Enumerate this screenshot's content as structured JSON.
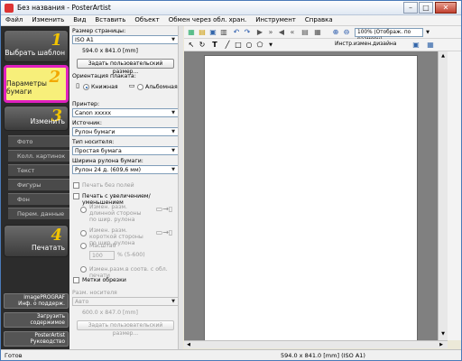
{
  "window": {
    "title": "Без названия - PosterArtist"
  },
  "menu": [
    "Файл",
    "Изменить",
    "Вид",
    "Вставить",
    "Объект",
    "Обмен через обл. хран.",
    "Инструмент",
    "Справка"
  ],
  "steps": {
    "s1": {
      "num": "1",
      "label": "Выбрать шаблон"
    },
    "s2": {
      "num": "2",
      "label": "Параметры бумаги"
    },
    "s3": {
      "num": "3",
      "label": "Изменить"
    },
    "s4": {
      "num": "4",
      "label": "Печатать"
    }
  },
  "subitems": [
    "Фото",
    "Колл. картинок",
    "Текст",
    "Фигуры",
    "Фон",
    "Перем. данные"
  ],
  "bottom": {
    "b1": [
      "imagePROGRAF",
      "Инф. о поддерж."
    ],
    "b2": [
      "Загрузить",
      "содержимое"
    ],
    "b3": [
      "PosterArtist",
      "Руководство"
    ]
  },
  "paper": {
    "size_label": "Размер страницы:",
    "size_value": "ISO A1",
    "size_dims": "594.0 x 841.0 [mm]",
    "custom_btn": "Задать пользовательский размер...",
    "orient_label": "Ориентация плаката:",
    "portrait": "Книжная",
    "landscape": "Альбомная",
    "printer_label": "Принтер:",
    "printer_value": "Canon xxxxx",
    "source_label": "Источник:",
    "source_value": "Рулон бумаги",
    "media_label": "Тип носителя:",
    "media_value": "Простая бумага",
    "roll_label": "Ширина рулона бумаги:",
    "roll_value": "Рулон 24 д. (609,6 мм)",
    "borderless": "Печать без полей",
    "enlarge": "Печать с увеличением/уменьшением",
    "opt1": "Измен. разм. длинной стороны по шир. рулона",
    "opt2": "Измен. разм. короткой стороны по шир. рулона",
    "scale": "Масштаб",
    "scale_value": "100",
    "scale_range": "% (5-600)",
    "fit": "Измен.разм.в соотв. с обл. печати",
    "crop": "Метки обрезки",
    "dis_media_label": "Разм. носителя",
    "dis_media_value": "Авто",
    "dis_dims": "600.0 x 847.0 [mm]",
    "dis_custom_btn": "Задать пользовательский размер..."
  },
  "toolbar": {
    "zoom": "100% (Отображ. по размеру)",
    "instr": "Инстр.измен.дизайна"
  },
  "status": {
    "left": "Готов",
    "center": "594.0 x 841.0 [mm] (ISO A1)"
  }
}
